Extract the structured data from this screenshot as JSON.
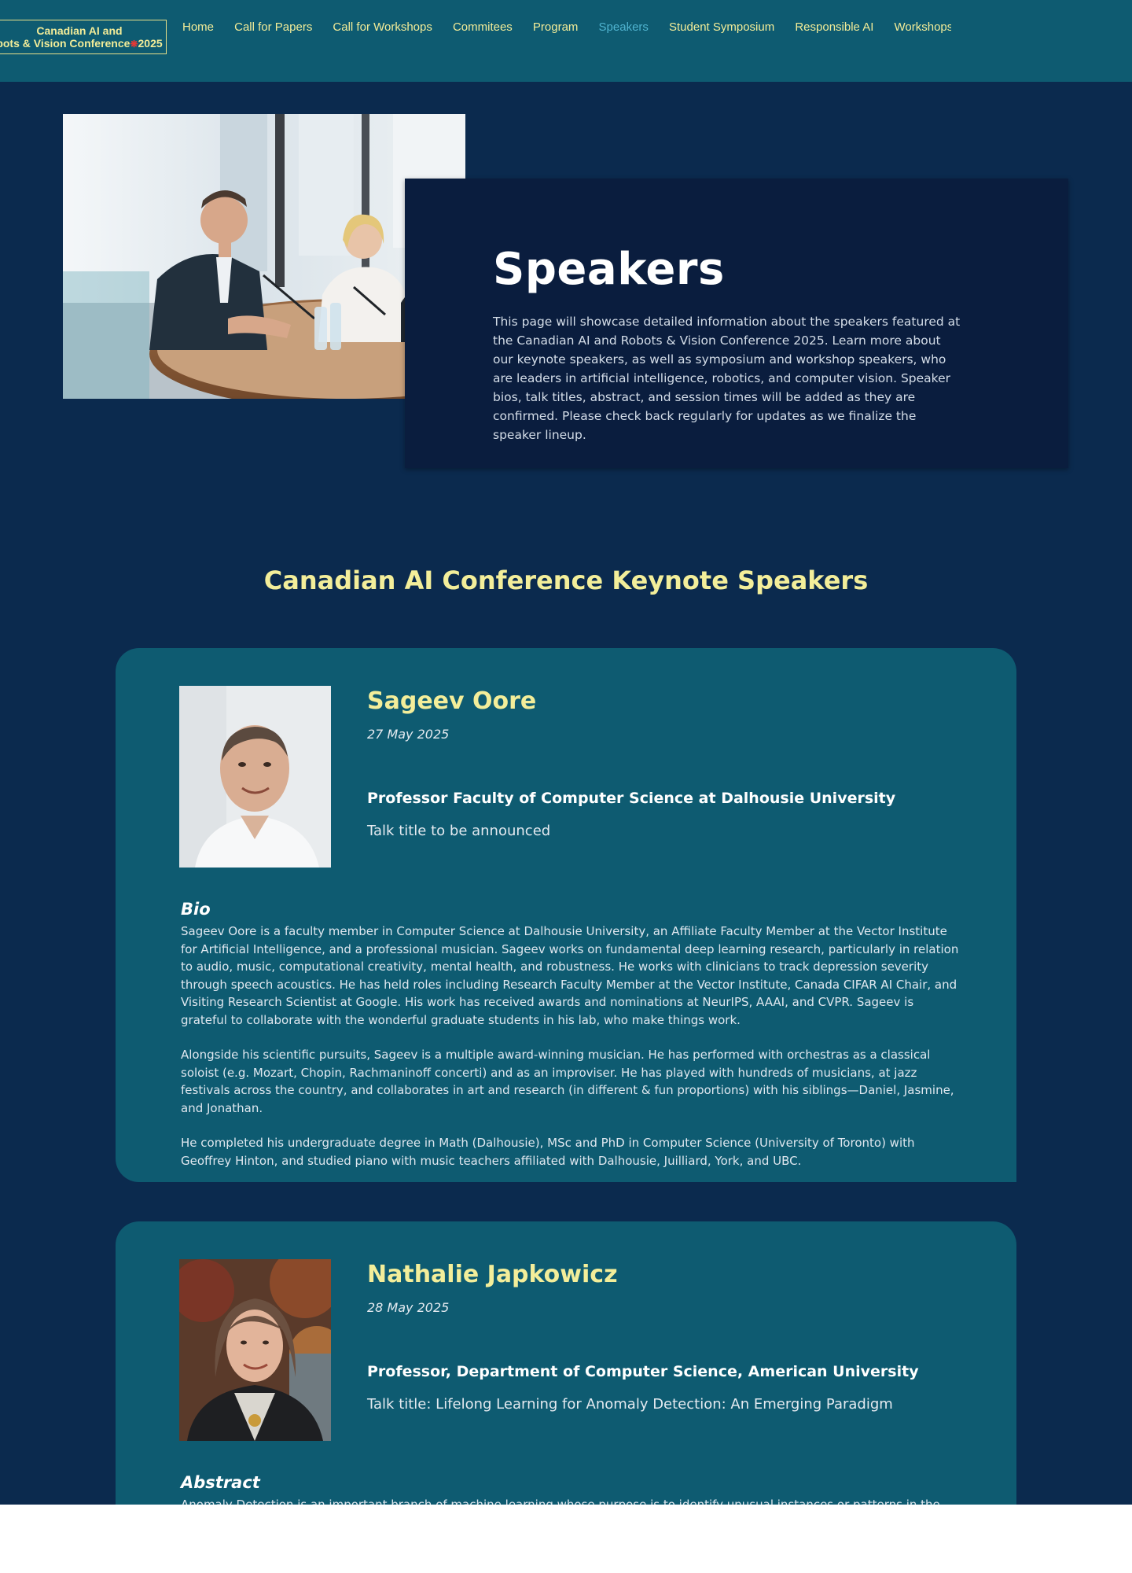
{
  "header": {
    "logo": {
      "line1": "Canadian AI and",
      "line2": "bots & Vision Conference",
      "year": "2025",
      "leaf_icon": "maple-leaf-icon"
    },
    "nav": [
      {
        "label": "Home",
        "active": false
      },
      {
        "label": "Call for Papers",
        "active": false
      },
      {
        "label": "Call for Workshops",
        "active": false
      },
      {
        "label": "Commitees",
        "active": false
      },
      {
        "label": "Program",
        "active": false
      },
      {
        "label": "Speakers",
        "active": true
      },
      {
        "label": "Student Symposium",
        "active": false
      },
      {
        "label": "Responsible AI",
        "active": false
      },
      {
        "label": "Workshops",
        "active": false
      }
    ]
  },
  "hero": {
    "title": "Speakers",
    "description": "This page will showcase detailed information about the speakers featured at the Canadian AI and Robots & Vision Conference 2025. Learn more about our keynote speakers, as well as symposium and workshop speakers, who are leaders in artificial intelligence, robotics, and computer vision. Speaker bios, talk titles, abstract, and session times will be added as they are confirmed. Please check back regularly for updates as we finalize the speaker lineup."
  },
  "section": {
    "title": "Canadian AI Conference Keynote Speakers"
  },
  "speakers": [
    {
      "name": "Sageev Oore",
      "date": "27 May 2025",
      "role": "Professor Faculty of Computer Science at Dalhousie University",
      "talk": "Talk title to be announced",
      "section_label": "Bio",
      "paragraphs": [
        "Sageev Oore is a faculty member in Computer Science at Dalhousie University, an Affiliate Faculty Member at the Vector Institute for Artificial Intelligence, and a professional musician. Sageev works on fundamental deep learning research, particularly in relation to audio, music, computational creativity, mental health, and robustness. He works with clinicians to track depression severity through speech acoustics. He has held roles including Research Faculty Member at the Vector Institute, Canada CIFAR AI Chair, and Visiting Research Scientist at Google. His work has received awards and nominations at NeurIPS, AAAI, and CVPR. Sageev is grateful to collaborate with the wonderful graduate students in his lab, who make things work.",
        "Alongside his scientific pursuits, Sageev is a multiple award-winning musician. He has performed with orchestras as a classical soloist (e.g. Mozart, Chopin, Rachmaninoff concerti) and as an improviser. He has played with hundreds of musicians, at jazz festivals across the country, and collaborates in art and research (in different & fun proportions) with his siblings—Daniel, Jasmine, and Jonathan.",
        "He completed his undergraduate degree in Math (Dalhousie), MSc and PhD in Computer Science (University of Toronto) with Geoffrey Hinton, and studied piano with music teachers affiliated with Dalhousie, Juilliard, York, and UBC."
      ]
    },
    {
      "name": "Nathalie Japkowicz",
      "date": "28 May 2025",
      "role": "Professor, Department of Computer Science, American University",
      "talk": "Talk title: Lifelong Learning for Anomaly Detection: An Emerging Paradigm",
      "section_label": "Abstract",
      "paragraphs": [
        "Anomaly Detection is an important branch of machine learning whose purpose is to identify unusual instances or patterns in the data. It"
      ]
    }
  ]
}
